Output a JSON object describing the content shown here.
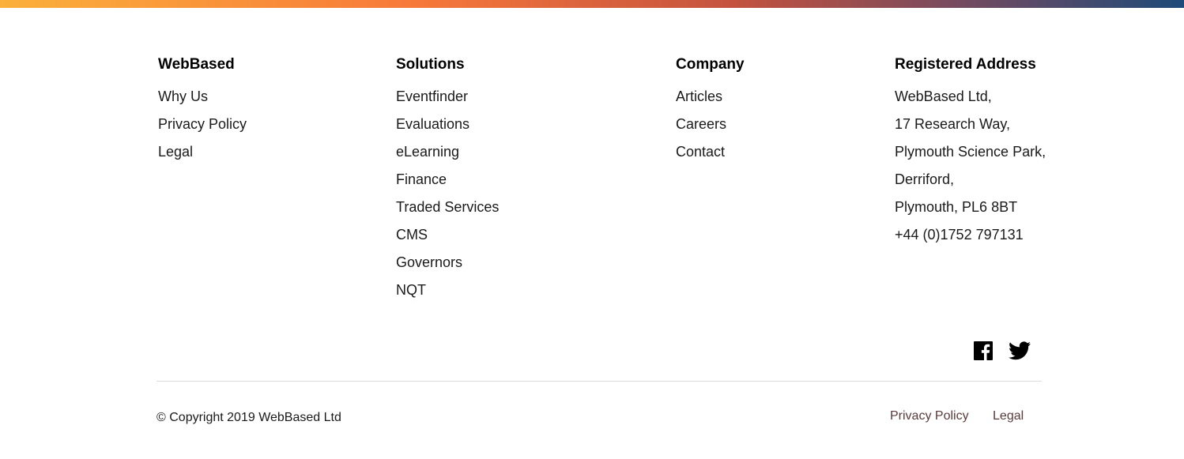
{
  "colors": {
    "gradient": [
      "#fbb03b",
      "#f7793a",
      "#c4523f",
      "#1e4a7a"
    ],
    "link_muted": "#5a3a3a"
  },
  "footer": {
    "columns": [
      {
        "heading": "WebBased",
        "items": [
          "Why Us",
          "Privacy Policy",
          "Legal"
        ]
      },
      {
        "heading": "Solutions",
        "items": [
          "Eventfinder",
          "Evaluations",
          "eLearning",
          "Finance",
          "Traded Services",
          "CMS",
          "Governors",
          "NQT"
        ]
      },
      {
        "heading": "Company",
        "items": [
          "Articles",
          "Careers",
          "Contact"
        ]
      },
      {
        "heading": "Registered Address",
        "items": [
          "WebBased Ltd,",
          "17 Research Way,",
          "Plymouth Science Park,",
          "Derriford,",
          "Plymouth, PL6 8BT",
          "+44 (0)1752 797131"
        ]
      }
    ],
    "social": {
      "icons": [
        "facebook-icon",
        "twitter-icon"
      ]
    },
    "copyright": "© Copyright 2019 WebBased Ltd",
    "bottom_links": {
      "privacy": "Privacy Policy",
      "legal": "Legal"
    }
  }
}
